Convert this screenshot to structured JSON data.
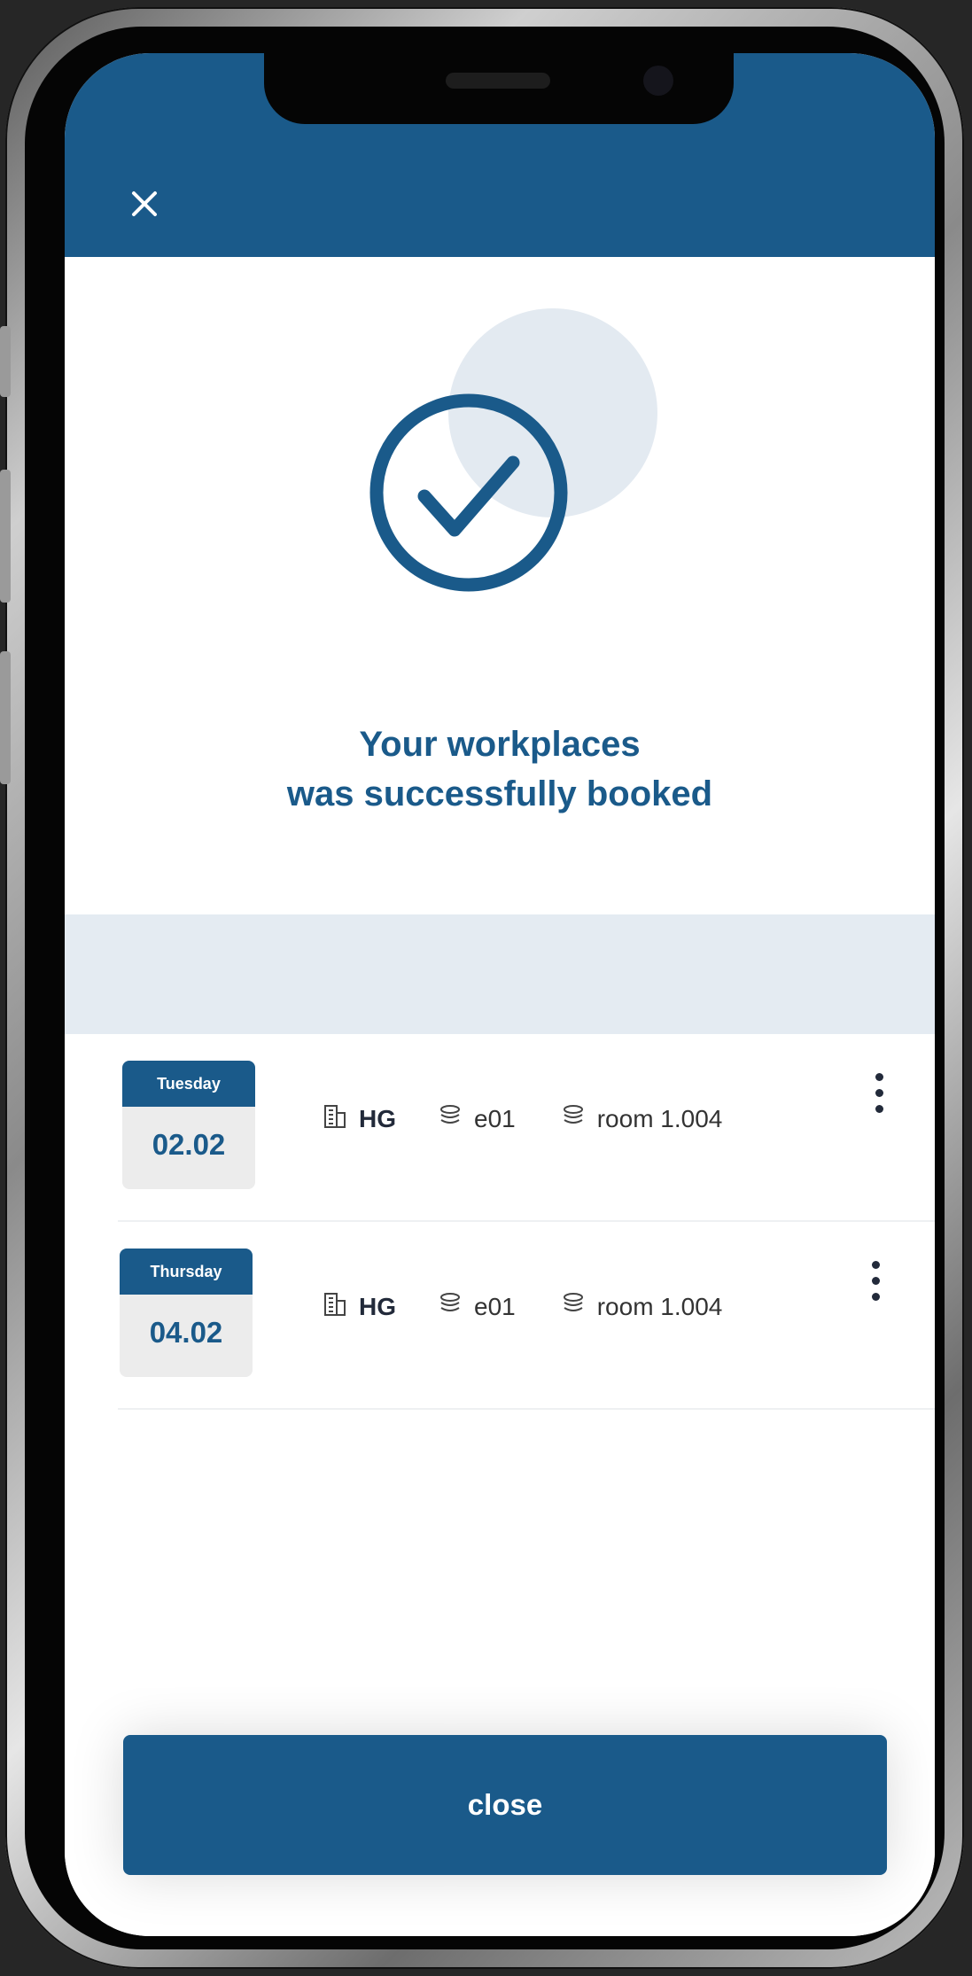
{
  "header": {
    "close_icon": "close-icon",
    "color": "#1a5a8a"
  },
  "success": {
    "icon": "checkmark-circle-icon",
    "line1": "Your workplaces",
    "line2": "was successfully booked"
  },
  "bookings": [
    {
      "day": "Tuesday",
      "date": "02.02",
      "building": "HG",
      "floor": "e01",
      "room": "room 1.004"
    },
    {
      "day": "Thursday",
      "date": "04.02",
      "building": "HG",
      "floor": "e01",
      "room": "room 1.004"
    }
  ],
  "footer": {
    "close_label": "close"
  }
}
